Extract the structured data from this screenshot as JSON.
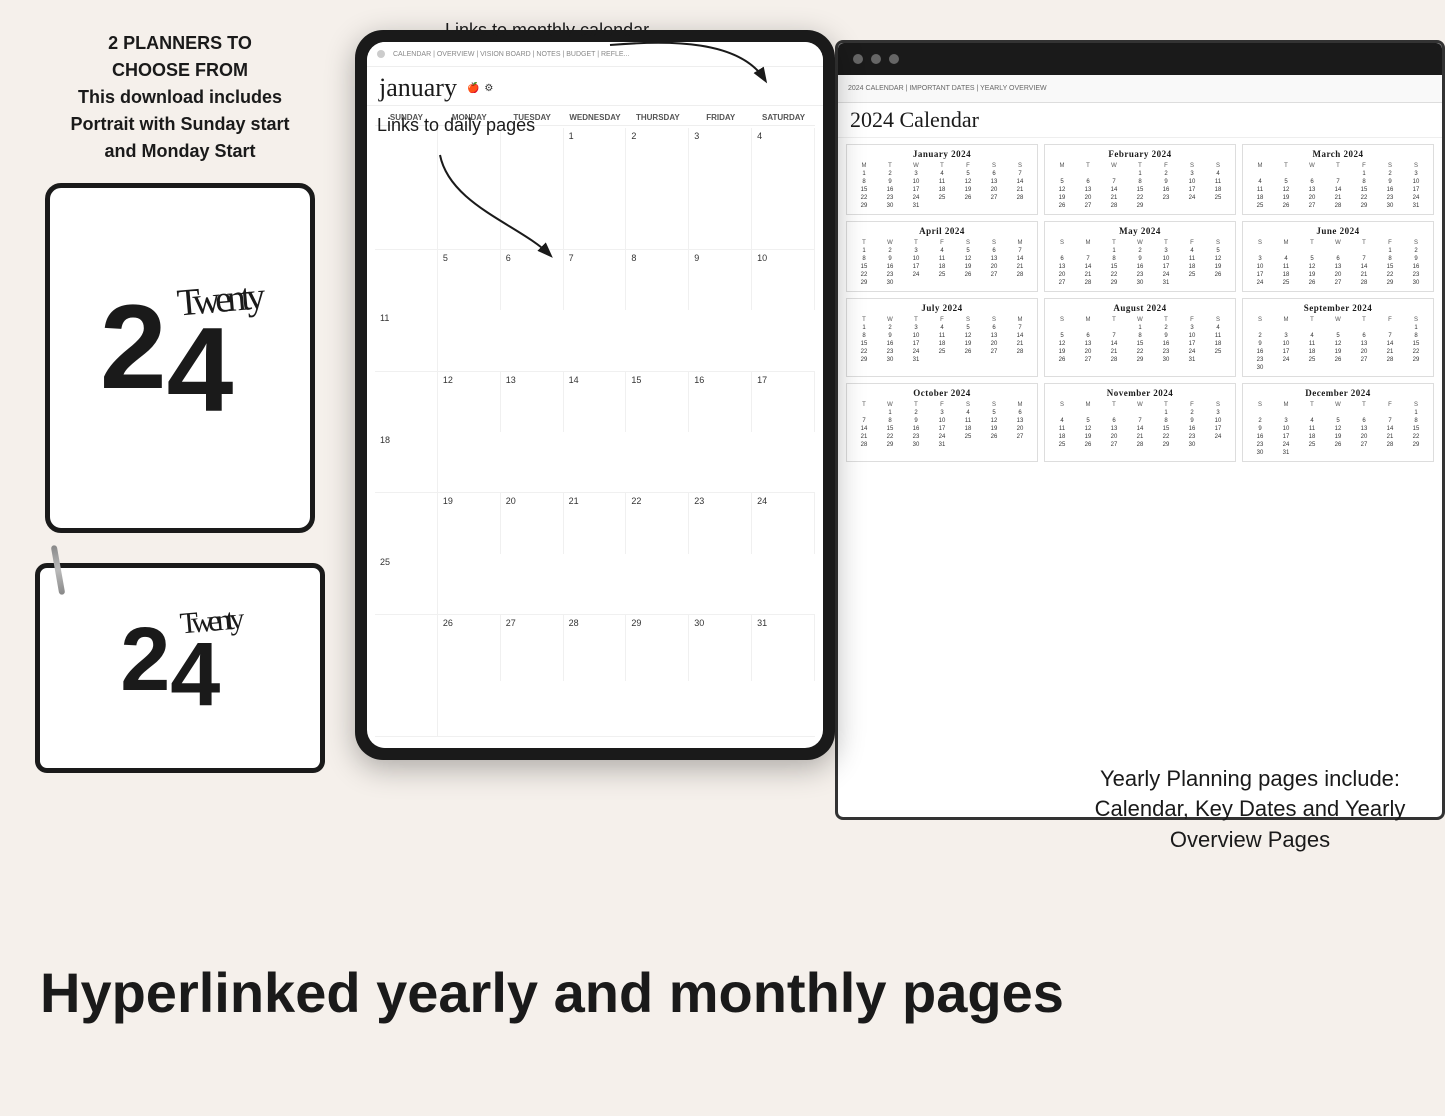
{
  "left": {
    "planners_count": "2 PLANNERS TO",
    "choose_from": "CHOOSE FROM",
    "download_includes": "This download includes",
    "portrait_sunday": "Portrait with Sunday start",
    "monday_start": "and Monday Start",
    "year_digit_2": "2",
    "year_digit_4": "4",
    "year_script": "Twenty"
  },
  "annotations": {
    "links_monthly": "Links to monthly calendar",
    "links_daily": "Links to daily pages",
    "arrow_monthly": "↗",
    "arrow_daily": "↘"
  },
  "right_bottom": {
    "yearly_text": "Yearly Planning pages include: Calendar, Key Dates and Yearly Overview Pages"
  },
  "bottom_headline": "Hyperlinked yearly and monthly pages",
  "center_tablet": {
    "nav_text": "CALENDAR | OVERVIEW | VISION BOARD | NOTES | BUDGET | REFLE...",
    "month_name": "january",
    "days_of_week": [
      "SUNDAY",
      "MONDAY",
      "TUESDAY",
      "WEDNESDAY",
      "THURSDAY",
      "FRIDAY",
      "SATURDAY"
    ],
    "weeks": [
      [
        "",
        "",
        "",
        "1",
        "2",
        "3",
        "4"
      ],
      [
        "5",
        "6",
        "7",
        "8",
        "9",
        "10",
        "11"
      ],
      [
        "",
        "12",
        "13",
        "14",
        "15",
        "16",
        "17",
        "18"
      ],
      [
        "",
        "19",
        "20",
        "21",
        "22",
        "23",
        "24",
        "25"
      ],
      [
        "",
        "26",
        "27",
        "28",
        "29",
        "30",
        "31",
        ""
      ]
    ]
  },
  "right_panel": {
    "title": "2024 Calendar",
    "nav": "2024 CALENDAR | IMPORTANT DATES | YEARLY OVERVIEW",
    "months": [
      {
        "name": "January 2024",
        "headers": [
          "M",
          "T",
          "W",
          "T",
          "F",
          "S",
          "S"
        ],
        "days": [
          "1",
          "2",
          "3",
          "4",
          "5",
          "6",
          "7",
          "8",
          "9",
          "10",
          "11",
          "12",
          "13",
          "14",
          "15",
          "16",
          "17",
          "18",
          "19",
          "20",
          "21",
          "22",
          "23",
          "24",
          "25",
          "26",
          "27",
          "28",
          "29",
          "30",
          "31"
        ]
      },
      {
        "name": "February 2024",
        "headers": [
          "M",
          "T",
          "W",
          "T",
          "F",
          "S",
          "S"
        ],
        "days": [
          "1",
          "2",
          "3",
          "4",
          "5",
          "6",
          "7",
          "8",
          "9",
          "10",
          "11",
          "12",
          "13",
          "14",
          "15",
          "16",
          "17",
          "18",
          "19",
          "20",
          "21",
          "22",
          "23",
          "24",
          "25",
          "26",
          "27",
          "28",
          "29"
        ]
      },
      {
        "name": "March 2024",
        "headers": [
          "M",
          "T",
          "W",
          "T",
          "F",
          "S",
          "S"
        ],
        "days": [
          "1",
          "2",
          "3",
          "4",
          "5",
          "6",
          "7",
          "8",
          "9",
          "10",
          "11",
          "12",
          "13",
          "14",
          "15",
          "16",
          "17",
          "18",
          "19",
          "20",
          "21",
          "22",
          "23",
          "24",
          "25",
          "26",
          "27",
          "28",
          "29",
          "30",
          "31"
        ]
      },
      {
        "name": "April 2024",
        "headers": [
          "T",
          "W",
          "T",
          "F",
          "S",
          "S",
          "M"
        ],
        "days": [
          "1",
          "2",
          "3",
          "4",
          "5",
          "6",
          "7",
          "8",
          "9",
          "10",
          "11",
          "12",
          "13",
          "14",
          "15",
          "16",
          "17",
          "18",
          "19",
          "20",
          "21",
          "22",
          "23",
          "24",
          "25",
          "26",
          "27",
          "28",
          "29",
          "30"
        ]
      },
      {
        "name": "May 2024",
        "headers": [
          "S",
          "M",
          "T",
          "W",
          "T",
          "F",
          "S"
        ],
        "days": [
          "1",
          "2",
          "3",
          "4",
          "5",
          "6",
          "7",
          "8",
          "9",
          "10",
          "11",
          "12",
          "13",
          "14",
          "15",
          "16",
          "17",
          "18",
          "19",
          "20",
          "21",
          "22",
          "23",
          "24",
          "25",
          "26",
          "27",
          "28",
          "29",
          "30",
          "31"
        ]
      },
      {
        "name": "June 2024",
        "headers": [
          "S",
          "M",
          "T",
          "W",
          "T",
          "F",
          "S"
        ],
        "days": [
          "1",
          "2",
          "3",
          "4",
          "5",
          "6",
          "7",
          "8",
          "9",
          "10",
          "11",
          "12",
          "13",
          "14",
          "15",
          "16",
          "17",
          "18",
          "19",
          "20",
          "21",
          "22",
          "23",
          "24",
          "25",
          "26",
          "27",
          "28",
          "29",
          "30"
        ]
      },
      {
        "name": "July 2024",
        "headers": [
          "T",
          "W",
          "T",
          "F",
          "S",
          "S",
          "M"
        ],
        "days": [
          "1",
          "2",
          "3",
          "4",
          "5",
          "6",
          "7",
          "8",
          "9",
          "10",
          "11",
          "12",
          "13",
          "14",
          "15",
          "16",
          "17",
          "18",
          "19",
          "20",
          "21",
          "22",
          "23",
          "24",
          "25",
          "26",
          "27",
          "28",
          "29",
          "30",
          "31"
        ]
      },
      {
        "name": "August 2024",
        "headers": [
          "S",
          "M",
          "T",
          "W",
          "T",
          "F",
          "S"
        ],
        "days": [
          "1",
          "2",
          "3",
          "4",
          "5",
          "6",
          "7",
          "8",
          "9",
          "10",
          "11",
          "12",
          "13",
          "14",
          "15",
          "16",
          "17",
          "18",
          "19",
          "20",
          "21",
          "22",
          "23",
          "24",
          "25",
          "26",
          "27",
          "28",
          "29",
          "30",
          "31"
        ]
      },
      {
        "name": "September 2024",
        "headers": [
          "S",
          "M",
          "T",
          "W",
          "T",
          "F",
          "S"
        ],
        "days": [
          "1",
          "2",
          "3",
          "4",
          "5",
          "6",
          "7",
          "8",
          "9",
          "10",
          "11",
          "12",
          "13",
          "14",
          "15",
          "16",
          "17",
          "18",
          "19",
          "20",
          "21",
          "22",
          "23",
          "24",
          "25",
          "26",
          "27",
          "28",
          "29",
          "30"
        ]
      },
      {
        "name": "October 2024",
        "headers": [
          "T",
          "W",
          "T",
          "F",
          "S",
          "S",
          "M"
        ],
        "days": [
          "1",
          "2",
          "3",
          "4",
          "5",
          "6",
          "7",
          "8",
          "9",
          "10",
          "11",
          "12",
          "13",
          "14",
          "15",
          "16",
          "17",
          "18",
          "19",
          "20",
          "21",
          "22",
          "23",
          "24",
          "25",
          "26",
          "27",
          "28",
          "29",
          "30",
          "31"
        ]
      },
      {
        "name": "November 2024",
        "headers": [
          "S",
          "M",
          "T",
          "W",
          "T",
          "F",
          "S"
        ],
        "days": [
          "1",
          "2",
          "3",
          "4",
          "5",
          "6",
          "7",
          "8",
          "9",
          "10",
          "11",
          "12",
          "13",
          "14",
          "15",
          "16",
          "17",
          "18",
          "19",
          "20",
          "21",
          "22",
          "23",
          "24",
          "25",
          "26",
          "27",
          "28",
          "29",
          "30"
        ]
      },
      {
        "name": "December 2024",
        "headers": [
          "S",
          "M",
          "T",
          "W",
          "T",
          "F",
          "S"
        ],
        "days": [
          "1",
          "2",
          "3",
          "4",
          "5",
          "6",
          "7",
          "8",
          "9",
          "10",
          "11",
          "12",
          "13",
          "14",
          "15",
          "16",
          "17",
          "18",
          "19",
          "20",
          "21",
          "22",
          "23",
          "24",
          "25",
          "26",
          "27",
          "28",
          "29",
          "30",
          "31"
        ]
      }
    ]
  }
}
